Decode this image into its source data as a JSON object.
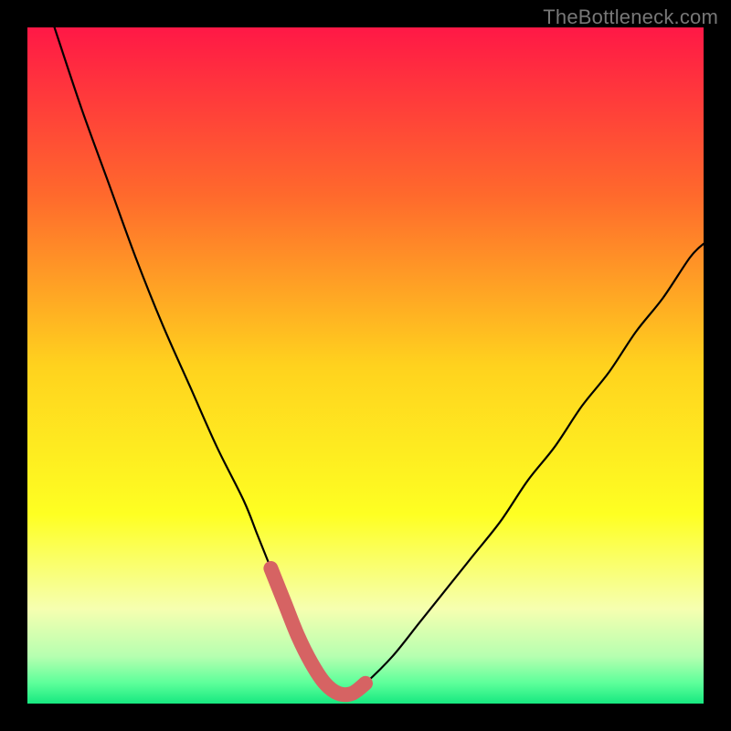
{
  "watermark": "TheBottleneck.com",
  "chart_data": {
    "type": "line",
    "title": "",
    "xlabel": "",
    "ylabel": "",
    "xlim": [
      0,
      100
    ],
    "ylim": [
      0,
      100
    ],
    "grid": false,
    "legend": false,
    "series": [
      {
        "name": "curve",
        "x": [
          4,
          8,
          12,
          16,
          20,
          24,
          28,
          32,
          34,
          36,
          38,
          40,
          42,
          44,
          46,
          48,
          50,
          54,
          58,
          62,
          66,
          70,
          74,
          78,
          82,
          86,
          90,
          94,
          98,
          100
        ],
        "y": [
          100,
          88,
          77,
          66,
          56,
          47,
          38,
          30,
          25,
          20,
          15,
          10,
          6,
          3,
          1.5,
          1.5,
          3,
          7,
          12,
          17,
          22,
          27,
          33,
          38,
          44,
          49,
          55,
          60,
          66,
          68
        ]
      }
    ],
    "highlight": {
      "name": "bottom-band",
      "x_range": [
        36,
        50
      ],
      "color": "#d66363"
    },
    "background": {
      "type": "vertical-gradient",
      "stops": [
        {
          "offset": 0.0,
          "color": "#ff1846"
        },
        {
          "offset": 0.25,
          "color": "#ff6a2c"
        },
        {
          "offset": 0.5,
          "color": "#ffd21e"
        },
        {
          "offset": 0.72,
          "color": "#feff22"
        },
        {
          "offset": 0.86,
          "color": "#f6ffb0"
        },
        {
          "offset": 0.93,
          "color": "#b6ffb0"
        },
        {
          "offset": 0.97,
          "color": "#5cff9a"
        },
        {
          "offset": 1.0,
          "color": "#17e880"
        }
      ]
    }
  }
}
